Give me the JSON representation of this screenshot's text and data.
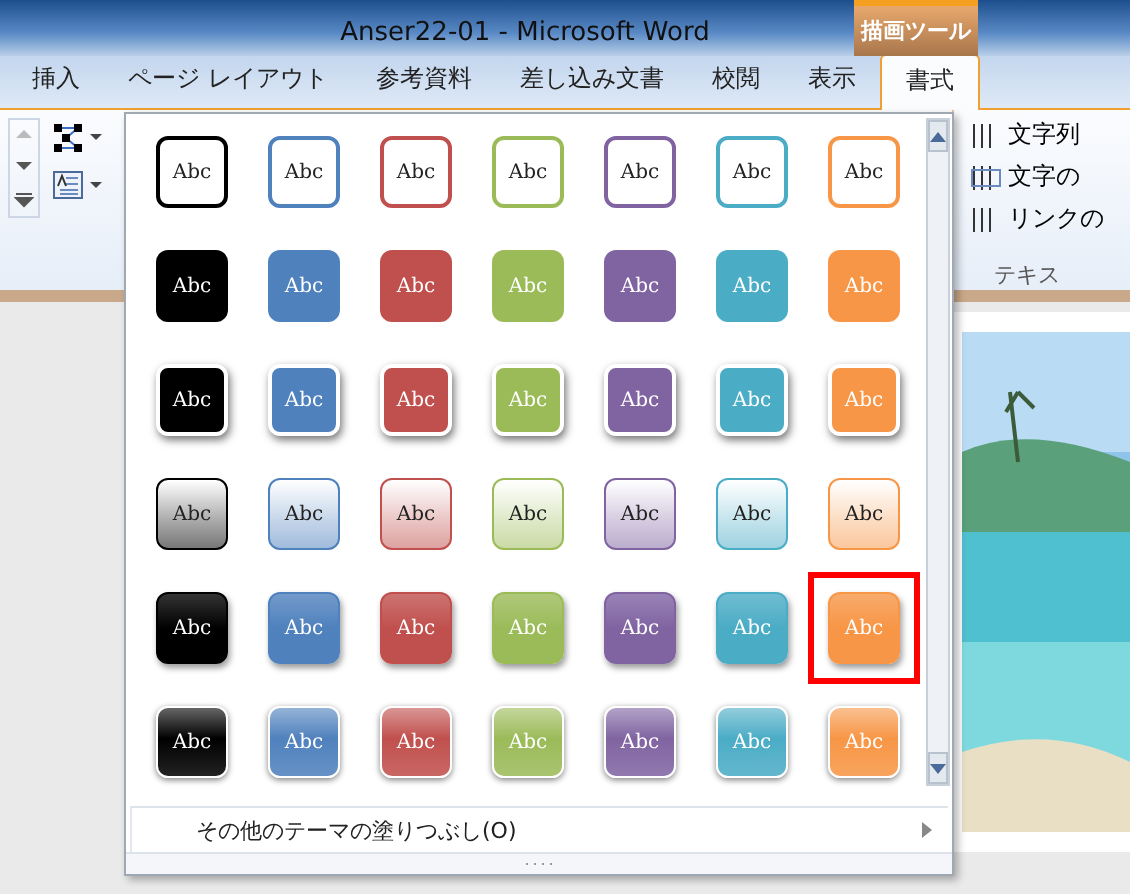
{
  "window": {
    "title": "Anser22-01  -  Microsoft Word",
    "context_tab": "描画ツール"
  },
  "tabs": [
    {
      "label": "挿入",
      "selected": false
    },
    {
      "label": "ページ レイアウト",
      "selected": false
    },
    {
      "label": "参考資料",
      "selected": false
    },
    {
      "label": "差し込み文書",
      "selected": false
    },
    {
      "label": "校閲",
      "selected": false
    },
    {
      "label": "表示",
      "selected": false
    },
    {
      "label": "書式",
      "selected": true
    }
  ],
  "ribbon_right": {
    "items": [
      "文字列",
      "文字の",
      "リンクの"
    ],
    "group_label": "テキス"
  },
  "gallery": {
    "rows": [
      {
        "kind": "outline",
        "swatches": [
          {
            "label": "Abc",
            "color": "#000000",
            "selected": false
          },
          {
            "label": "Abc",
            "color": "#4f81bd",
            "selected": false
          },
          {
            "label": "Abc",
            "color": "#c0504d",
            "selected": false
          },
          {
            "label": "Abc",
            "color": "#9bbb59",
            "selected": false
          },
          {
            "label": "Abc",
            "color": "#8064a2",
            "selected": false
          },
          {
            "label": "Abc",
            "color": "#4bacc6",
            "selected": false
          },
          {
            "label": "Abc",
            "color": "#f79646",
            "selected": false
          }
        ]
      },
      {
        "kind": "solid",
        "swatches": [
          {
            "label": "Abc",
            "color": "#000000",
            "selected": false
          },
          {
            "label": "Abc",
            "color": "#4f81bd",
            "selected": false
          },
          {
            "label": "Abc",
            "color": "#c0504d",
            "selected": false
          },
          {
            "label": "Abc",
            "color": "#9bbb59",
            "selected": false
          },
          {
            "label": "Abc",
            "color": "#8064a2",
            "selected": false
          },
          {
            "label": "Abc",
            "color": "#4bacc6",
            "selected": false
          },
          {
            "label": "Abc",
            "color": "#f79646",
            "selected": false
          }
        ]
      },
      {
        "kind": "framed",
        "swatches": [
          {
            "label": "Abc",
            "color": "#000000",
            "selected": false
          },
          {
            "label": "Abc",
            "color": "#4f81bd",
            "selected": false
          },
          {
            "label": "Abc",
            "color": "#c0504d",
            "selected": false
          },
          {
            "label": "Abc",
            "color": "#9bbb59",
            "selected": false
          },
          {
            "label": "Abc",
            "color": "#8064a2",
            "selected": false
          },
          {
            "label": "Abc",
            "color": "#4bacc6",
            "selected": false
          },
          {
            "label": "Abc",
            "color": "#f79646",
            "selected": false
          }
        ]
      },
      {
        "kind": "light",
        "swatches": [
          {
            "label": "Abc",
            "color": "#000000",
            "selected": false
          },
          {
            "label": "Abc",
            "color": "#4f81bd",
            "selected": false
          },
          {
            "label": "Abc",
            "color": "#c0504d",
            "selected": false
          },
          {
            "label": "Abc",
            "color": "#9bbb59",
            "selected": false
          },
          {
            "label": "Abc",
            "color": "#8064a2",
            "selected": false
          },
          {
            "label": "Abc",
            "color": "#4bacc6",
            "selected": false
          },
          {
            "label": "Abc",
            "color": "#f79646",
            "selected": false
          }
        ]
      },
      {
        "kind": "intense",
        "swatches": [
          {
            "label": "Abc",
            "color": "#000000",
            "selected": false
          },
          {
            "label": "Abc",
            "color": "#4f81bd",
            "selected": false
          },
          {
            "label": "Abc",
            "color": "#c0504d",
            "selected": false
          },
          {
            "label": "Abc",
            "color": "#9bbb59",
            "selected": false
          },
          {
            "label": "Abc",
            "color": "#8064a2",
            "selected": false
          },
          {
            "label": "Abc",
            "color": "#4bacc6",
            "selected": false
          },
          {
            "label": "Abc",
            "color": "#f79646",
            "selected": true
          }
        ]
      },
      {
        "kind": "bright",
        "swatches": [
          {
            "label": "Abc",
            "color": "#000000",
            "selected": false
          },
          {
            "label": "Abc",
            "color": "#4f81bd",
            "selected": false
          },
          {
            "label": "Abc",
            "color": "#c0504d",
            "selected": false
          },
          {
            "label": "Abc",
            "color": "#9bbb59",
            "selected": false
          },
          {
            "label": "Abc",
            "color": "#8064a2",
            "selected": false
          },
          {
            "label": "Abc",
            "color": "#4bacc6",
            "selected": false
          },
          {
            "label": "Abc",
            "color": "#f79646",
            "selected": false
          }
        ]
      }
    ],
    "more_item": "その他のテーマの塗りつぶし(O)"
  }
}
